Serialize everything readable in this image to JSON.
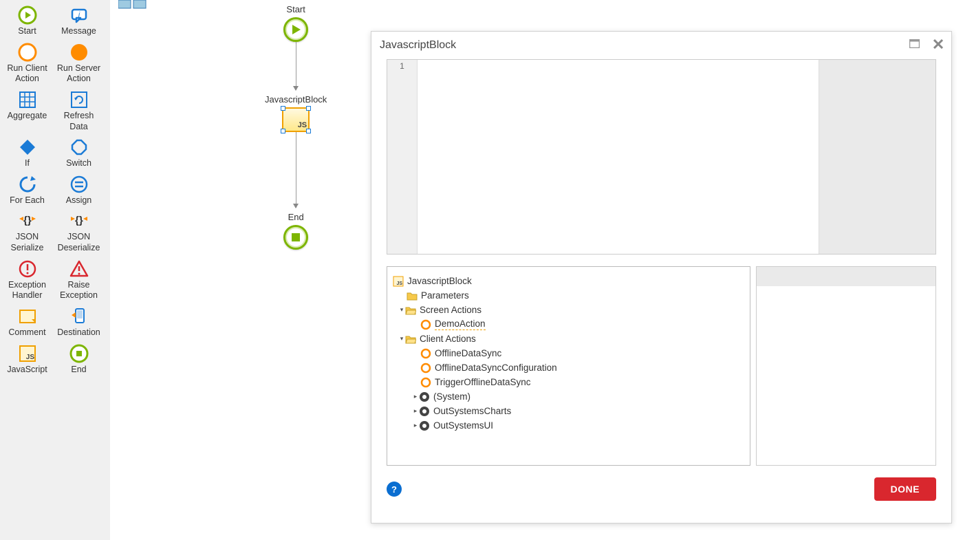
{
  "toolbox": {
    "items": [
      {
        "label": "Start",
        "icon": "start"
      },
      {
        "label": "Message",
        "icon": "message"
      },
      {
        "label": "Run Client Action",
        "icon": "run-client"
      },
      {
        "label": "Run Server Action",
        "icon": "run-server"
      },
      {
        "label": "Aggregate",
        "icon": "aggregate"
      },
      {
        "label": "Refresh Data",
        "icon": "refresh"
      },
      {
        "label": "If",
        "icon": "if"
      },
      {
        "label": "Switch",
        "icon": "switch"
      },
      {
        "label": "For Each",
        "icon": "foreach"
      },
      {
        "label": "Assign",
        "icon": "assign"
      },
      {
        "label": "JSON Serialize",
        "icon": "json-ser"
      },
      {
        "label": "JSON Deserialize",
        "icon": "json-deser"
      },
      {
        "label": "Exception Handler",
        "icon": "exc-handler"
      },
      {
        "label": "Raise Exception",
        "icon": "exc-raise"
      },
      {
        "label": "Comment",
        "icon": "comment"
      },
      {
        "label": "Destination",
        "icon": "destination"
      },
      {
        "label": "JavaScript",
        "icon": "javascript"
      },
      {
        "label": "End",
        "icon": "end"
      }
    ]
  },
  "flow": {
    "start_label": "Start",
    "js_label": "JavascriptBlock",
    "js_badge": "JS",
    "end_label": "End"
  },
  "dialog": {
    "title": "JavascriptBlock",
    "gutter_line": "1",
    "done_label": "DONE",
    "help_label": "?"
  },
  "tree": {
    "root": "JavascriptBlock",
    "parameters": "Parameters",
    "screen_actions": "Screen Actions",
    "screen_actions_children": [
      {
        "label": "DemoAction",
        "wavy": true
      }
    ],
    "client_actions": "Client Actions",
    "client_actions_children": [
      {
        "label": "OfflineDataSync",
        "icon": "ring"
      },
      {
        "label": "OfflineDataSyncConfiguration",
        "icon": "ring"
      },
      {
        "label": "TriggerOfflineDataSync",
        "icon": "ring"
      },
      {
        "label": "(System)",
        "icon": "module"
      },
      {
        "label": "OutSystemsCharts",
        "icon": "module"
      },
      {
        "label": "OutSystemsUI",
        "icon": "module"
      }
    ]
  }
}
